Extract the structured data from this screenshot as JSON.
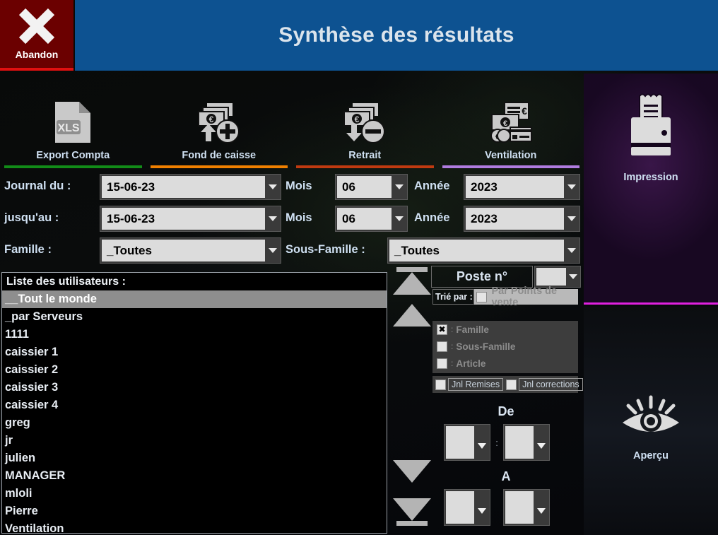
{
  "window": {
    "title": "Synthèse des résultats",
    "abandon_label": "Abandon",
    "abandon_icon": "close-x-icon",
    "header_color": "#0d5291",
    "abandon_color": "#6b0000"
  },
  "toolbar": {
    "tabs": [
      {
        "label": "Export Compta",
        "icon": "xls-file-icon",
        "underline_color": "#128c18"
      },
      {
        "label": "Fond de caisse",
        "icon": "cash-plus-icon",
        "underline_color": "#f08000"
      },
      {
        "label": "Retrait",
        "icon": "cash-minus-icon",
        "underline_color": "#c03a10"
      },
      {
        "label": "Ventilation",
        "icon": "payment-methods-icon",
        "underline_color": "#b07ce0"
      }
    ]
  },
  "form": {
    "journal_du_label": "Journal du :",
    "journal_du_value": "15-06-23",
    "journal_du_mois_label": "Mois",
    "journal_du_mois_value": "06",
    "journal_du_annee_label": "Année",
    "journal_du_annee_value": "2023",
    "jusquau_label": "jusqu'au :",
    "jusquau_value": "15-06-23",
    "jusquau_mois_label": "Mois",
    "jusquau_mois_value": "06",
    "jusquau_annee_label": "Année",
    "jusquau_annee_value": "2023",
    "famille_label": "Famille :",
    "famille_value": "_Toutes",
    "sous_famille_label": "Sous-Famille :",
    "sous_famille_value": "_Toutes"
  },
  "users": {
    "header": "Liste des utilisateurs :",
    "items": [
      {
        "label": "__Tout le monde",
        "selected": true
      },
      {
        "label": "_par Serveurs",
        "selected": false
      },
      {
        "label": "1111",
        "selected": false
      },
      {
        "label": "caissier 1",
        "selected": false
      },
      {
        "label": "caissier 2",
        "selected": false
      },
      {
        "label": "caissier 3",
        "selected": false
      },
      {
        "label": "caissier 4",
        "selected": false
      },
      {
        "label": "greg",
        "selected": false
      },
      {
        "label": "jr",
        "selected": false
      },
      {
        "label": "julien",
        "selected": false
      },
      {
        "label": "MANAGER",
        "selected": false
      },
      {
        "label": "mloli",
        "selected": false
      },
      {
        "label": "Pierre",
        "selected": false
      },
      {
        "label": "Ventilation",
        "selected": false
      }
    ]
  },
  "nav": {
    "first_icon": "go-to-first-icon",
    "up_icon": "scroll-up-icon",
    "down_icon": "scroll-down-icon",
    "last_icon": "go-to-last-icon"
  },
  "filters": {
    "poste_label": "Poste n°",
    "poste_value": "",
    "trie_par_label": "Trié par :",
    "par_points_de_vente_label": "Par Points de vente",
    "par_points_de_vente_checked": false,
    "groups": [
      {
        "label": "Famille",
        "checked": true
      },
      {
        "label": "Sous-Famille",
        "checked": false
      },
      {
        "label": "Article",
        "checked": false
      }
    ],
    "jnl_remises_label": "Jnl Remises",
    "jnl_remises_checked": false,
    "jnl_corrections_label": "Jnl corrections",
    "jnl_corrections_checked": false,
    "de_label": "De",
    "de_value_1": "",
    "de_value_2": "",
    "de_separator": ":",
    "a_label": "A",
    "a_value_1": "",
    "a_value_2": ""
  },
  "sidebar": {
    "impression_label": "Impression",
    "impression_icon": "printer-icon",
    "apercu_label": "Aperçu",
    "apercu_icon": "eye-preview-icon",
    "divider_color": "#e020e0"
  }
}
